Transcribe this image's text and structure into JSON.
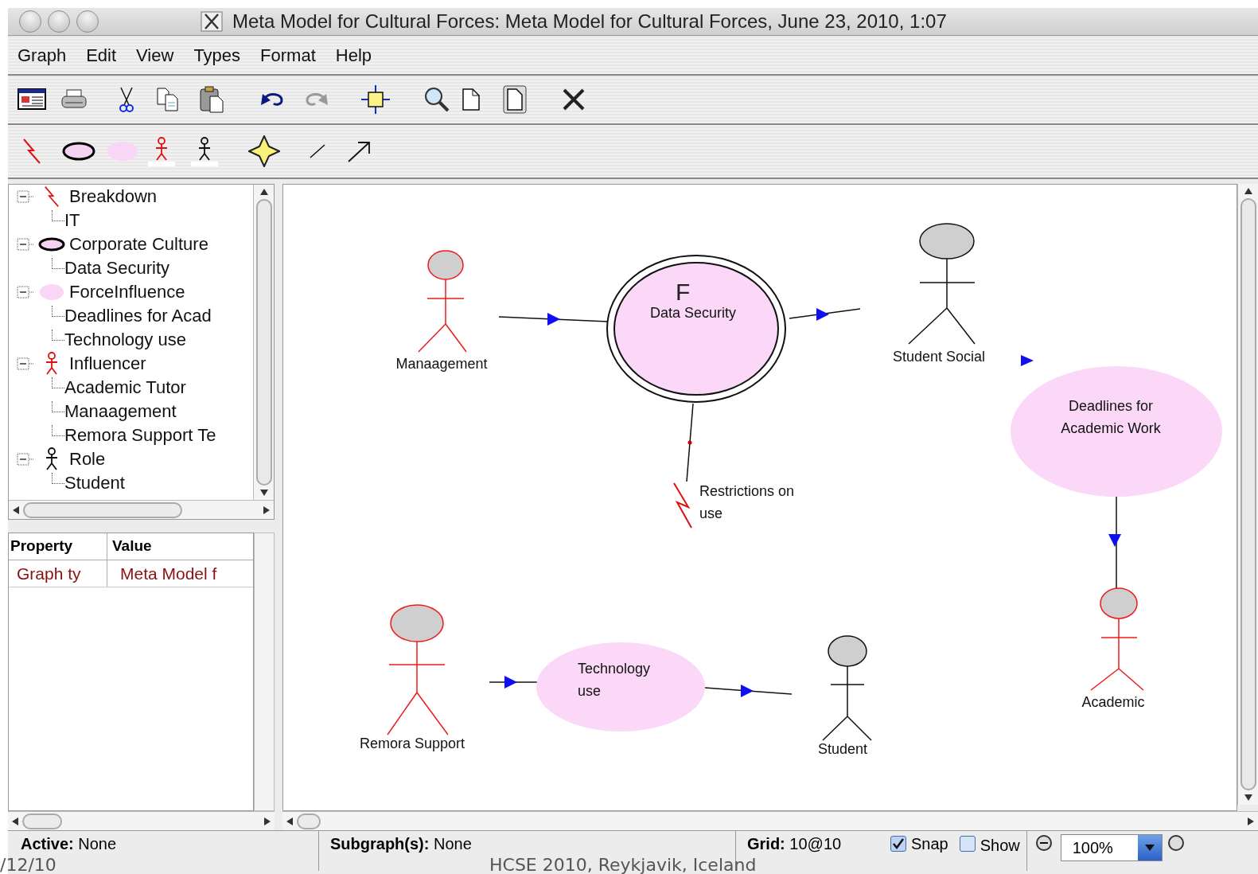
{
  "window": {
    "title": "Meta Model for Cultural Forces: Meta Model for Cultural Forces, June 23, 2010, 1:07"
  },
  "menu": [
    "Graph",
    "Edit",
    "View",
    "Types",
    "Format",
    "Help"
  ],
  "tree": [
    {
      "kind": "breakdown",
      "label": "Breakdown",
      "expanded": true,
      "children": [
        {
          "label": "IT"
        }
      ]
    },
    {
      "kind": "culture",
      "label": "Corporate Culture",
      "expanded": true,
      "children": [
        {
          "label": "Data Security"
        }
      ]
    },
    {
      "kind": "force",
      "label": "ForceInfluence",
      "expanded": true,
      "children": [
        {
          "label": "Deadlines for Acad"
        },
        {
          "label": "Technology use"
        }
      ]
    },
    {
      "kind": "influencer",
      "label": "Influencer",
      "expanded": true,
      "children": [
        {
          "label": "Academic Tutor"
        },
        {
          "label": "Manaagement"
        },
        {
          "label": "Remora Support Te"
        }
      ]
    },
    {
      "kind": "role",
      "label": "Role",
      "expanded": true,
      "children": [
        {
          "label": "Student"
        }
      ]
    }
  ],
  "properties": {
    "columns": [
      "Property",
      "Value"
    ],
    "rows": [
      [
        "Graph ty",
        "Meta Model f"
      ]
    ]
  },
  "canvas": {
    "nodes": [
      {
        "kind": "influencer",
        "lines": [
          "Manaagement"
        ]
      },
      {
        "kind": "culture",
        "lines": [
          "Data Security"
        ],
        "marker": "F"
      },
      {
        "kind": "role",
        "lines": [
          "Student Social"
        ]
      },
      {
        "kind": "force",
        "lines": [
          "Deadlines for",
          "Academic Work"
        ]
      },
      {
        "kind": "breakdown",
        "lines": [
          "Restrictions on",
          "use"
        ]
      },
      {
        "kind": "influencer",
        "lines": [
          "Academic"
        ]
      },
      {
        "kind": "influencer",
        "lines": [
          "Remora Support"
        ]
      },
      {
        "kind": "force",
        "lines": [
          "Technology",
          "use"
        ]
      },
      {
        "kind": "role",
        "lines": [
          "Student"
        ]
      }
    ]
  },
  "status_bar": {
    "active_label": "Active:",
    "active": "None",
    "subgraph_label": "Subgraph(s):",
    "subgraph": "None",
    "grid_label": "Grid:",
    "grid": "10@10",
    "snap": {
      "label": "Snap",
      "checked": true
    },
    "show": {
      "label": "Show",
      "checked": false
    },
    "zoom": "100%"
  },
  "slide_footer": {
    "date": "/12/10",
    "venue": "HCSE 2010, Reykjavik, Iceland"
  }
}
